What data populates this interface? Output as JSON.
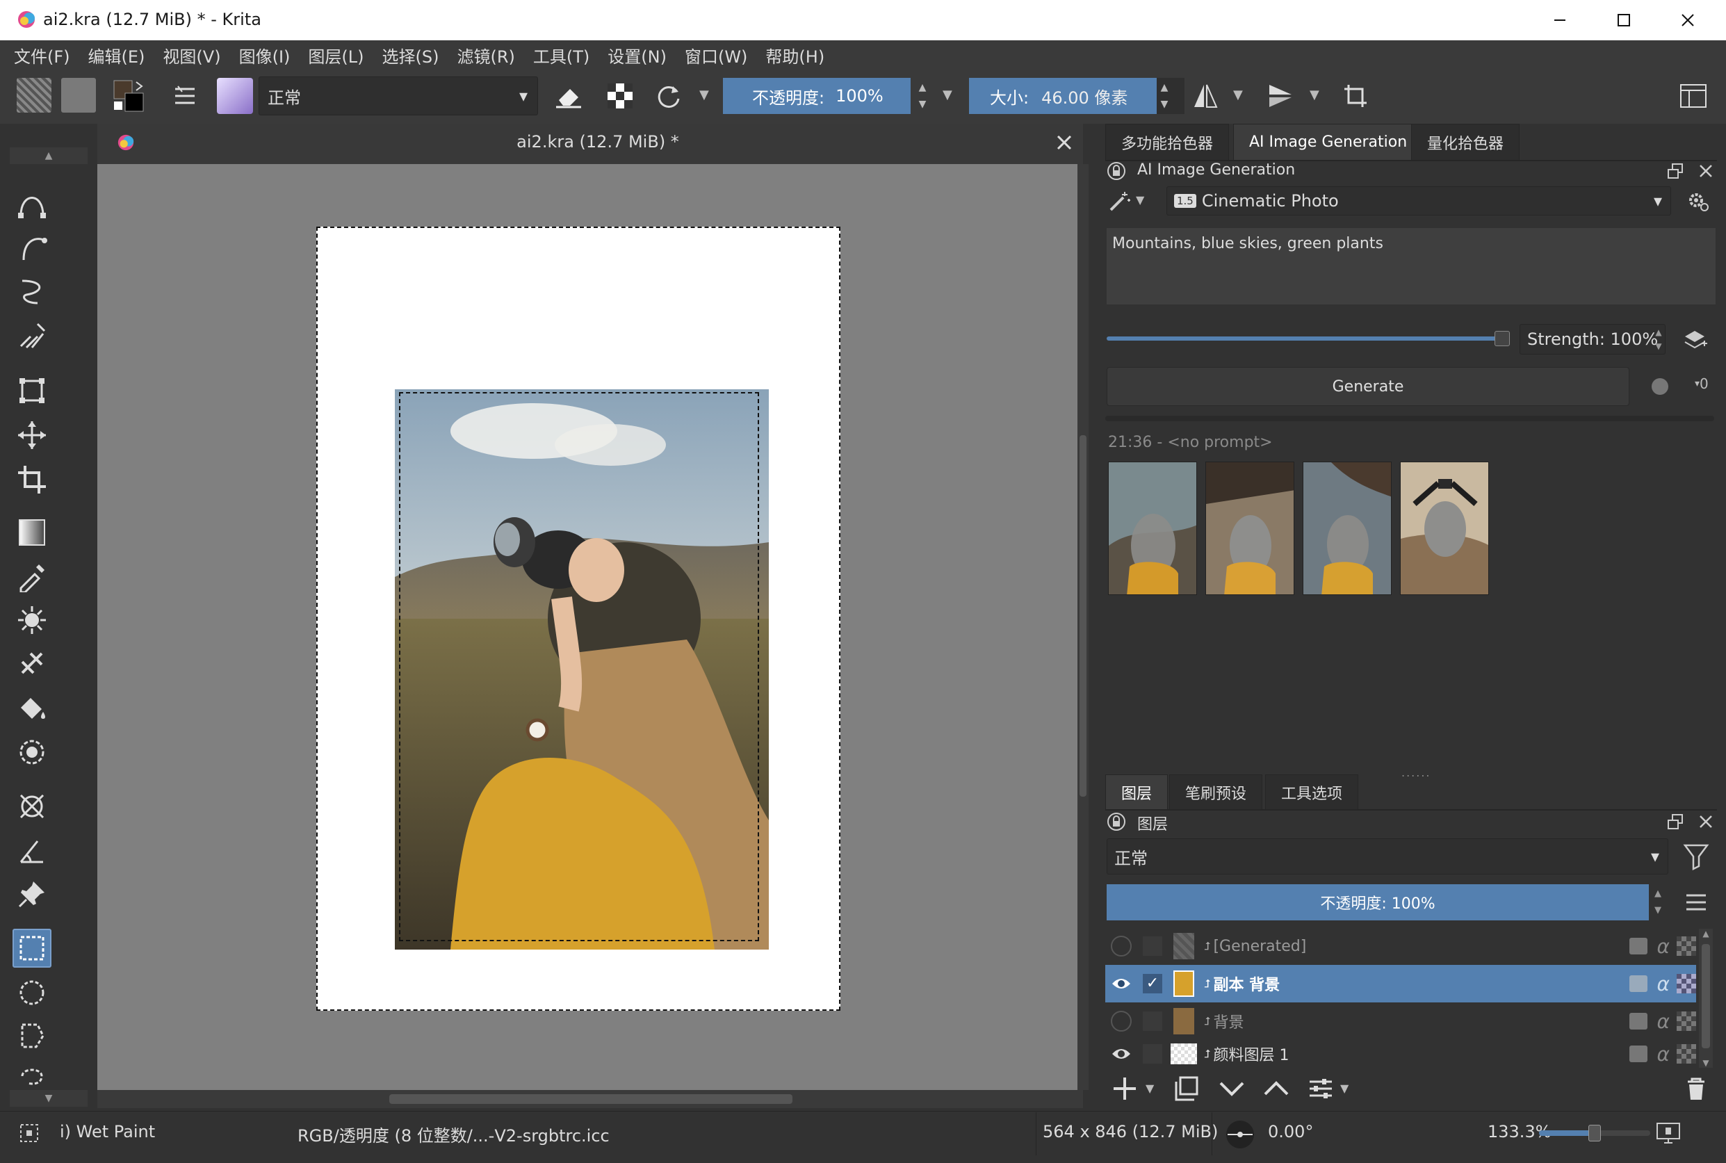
{
  "window": {
    "title": "ai2.kra (12.7 MiB) * - Krita"
  },
  "menu": [
    "文件(F)",
    "编辑(E)",
    "视图(V)",
    "图像(I)",
    "图层(L)",
    "选择(S)",
    "滤镜(R)",
    "工具(T)",
    "设置(N)",
    "窗口(W)",
    "帮助(H)"
  ],
  "toolbar": {
    "blend_mode": "正常",
    "opacity_label": "不透明度:",
    "opacity_value": "100%",
    "size_label": "大小:",
    "size_value": "46.00 像素"
  },
  "document": {
    "tab_title": "ai2.kra (12.7 MiB) *"
  },
  "right_tabs": [
    "多功能拾色器",
    "AI Image Generation",
    "量化拾色器"
  ],
  "ai_panel": {
    "title": "AI Image Generation",
    "style": "Cinematic Photo",
    "style_badge": "1.5",
    "prompt": "Mountains, blue skies, green plants",
    "strength_label": "Strength: 100%",
    "strength_value": 1.0,
    "generate_label": "Generate",
    "batch_count": "0",
    "history_label": "21:36 - <no prompt>"
  },
  "bottom_tabs": [
    "图层",
    "笔刷预设",
    "工具选项"
  ],
  "layers_panel": {
    "title": "图层",
    "blend_mode": "正常",
    "opacity_label": "不透明度:  100%",
    "opacity_value": 1.0,
    "layers": [
      {
        "name": "[Generated]",
        "visible": false,
        "selected": false
      },
      {
        "name": "副本 背景",
        "visible": true,
        "selected": true
      },
      {
        "name": "背景",
        "visible": false,
        "selected": false
      },
      {
        "name": "颜料图层 1",
        "visible": true,
        "selected": false
      }
    ]
  },
  "status": {
    "brush": "i) Wet Paint",
    "color_profile": "RGB/透明度 (8 位整数/...-V2-srgbtrc.icc",
    "dimensions": "564 x 846 (12.7 MiB)",
    "rotation": "0.00°",
    "zoom": "133.3%",
    "zoom_slider_value": 0.5
  },
  "colors": {
    "accent": "#5480b0",
    "panel": "#323232",
    "canvas_bg": "#808080"
  }
}
